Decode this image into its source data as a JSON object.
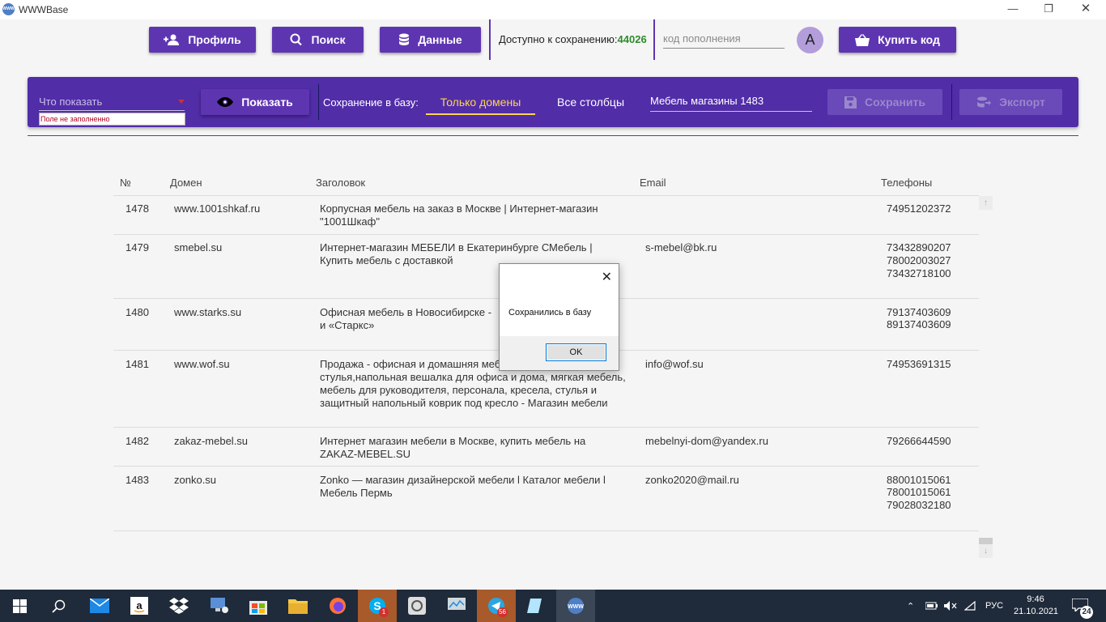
{
  "window": {
    "title": "WWWBase",
    "icon_text": "WWW",
    "controls": {
      "minimize": "—",
      "restore": "❐",
      "close": "✕"
    }
  },
  "toolbar": {
    "profile_label": "Профиль",
    "search_label": "Поиск",
    "data_label": "Данные",
    "available_label": "Доступно к сохранению:",
    "available_count": "44026",
    "code_placeholder": "код пополнения",
    "avatar_letter": "A",
    "buy_label": "Купить код"
  },
  "panel": {
    "select_placeholder": "Что показать",
    "select_error": "Поле не заполненно",
    "show_label": "Показать",
    "save_to_db_label": "Сохранение в базу:",
    "tab_domains": "Только домены",
    "tab_all_columns": "Все столбцы",
    "name_value": "Мебель магазины 1483",
    "save_label": "Сохранить",
    "export_label": "Экспорт"
  },
  "table": {
    "headers": {
      "num": "№",
      "domain": "Домен",
      "title": "Заголовок",
      "email": "Email",
      "phones": "Телефоны"
    },
    "rows": [
      {
        "num": "1478",
        "domain": "www.1001shkaf.ru",
        "title": "Корпусная мебель на заказ в Москве | Интернет-магазин \"1001Шкаф\"",
        "email": "",
        "phones": [
          "74951202372"
        ]
      },
      {
        "num": "1479",
        "domain": "smebel.su",
        "title": "Интернет-магазин МЕБЕЛИ в Екатеринбурге СМебель | Купить мебель с доставкой",
        "email": "s-mebel@bk.ru",
        "phones": [
          "73432890207",
          "78002003027",
          "73432718100"
        ]
      },
      {
        "num": "1480",
        "domain": "www.starks.su",
        "title": "Офисная мебель в Новосибирске - и «Старкс»",
        "email": "",
        "phones": [
          "79137403609",
          "89137403609"
        ]
      },
      {
        "num": "1481",
        "domain": "www.wof.su",
        "title": "Продажа - офисная и домашняя меб , обеденный стол и стулья,напольная вешалка для офиса и дома, мягкая мебель, мебель для руководителя, персонала, кресела, стулья и защитный напольный коврик под кресло - Магазин мебели",
        "email": "info@wof.su",
        "phones": [
          "74953691315"
        ]
      },
      {
        "num": "1482",
        "domain": "zakaz-mebel.su",
        "title": "Интернет магазин мебели в Москве, купить мебель на ZAKAZ-MEBEL.SU",
        "email": "mebelnyi-dom@yandex.ru",
        "phones": [
          "79266644590"
        ]
      },
      {
        "num": "1483",
        "domain": "zonko.su",
        "title": "Zonko — магазин дизайнерской мебели l Каталог мебели l Мебель Пермь",
        "email": "zonko2020@mail.ru",
        "phones": [
          "88001015061",
          "78001015061",
          "79028032180"
        ]
      }
    ]
  },
  "dialog": {
    "message": "Сохранились в базу",
    "ok_label": "OK",
    "close_glyph": "✕"
  },
  "taskbar": {
    "badge_skype": "1",
    "badge_telegram": "56",
    "lang": "РУС",
    "time": "9:46",
    "date": "21.10.2021",
    "notifications": "24"
  },
  "colors": {
    "accent": "#5e35b1",
    "panel": "#512da8",
    "highlight": "#ffd54f",
    "count_green": "#2e8b2e",
    "error": "#b00020"
  }
}
